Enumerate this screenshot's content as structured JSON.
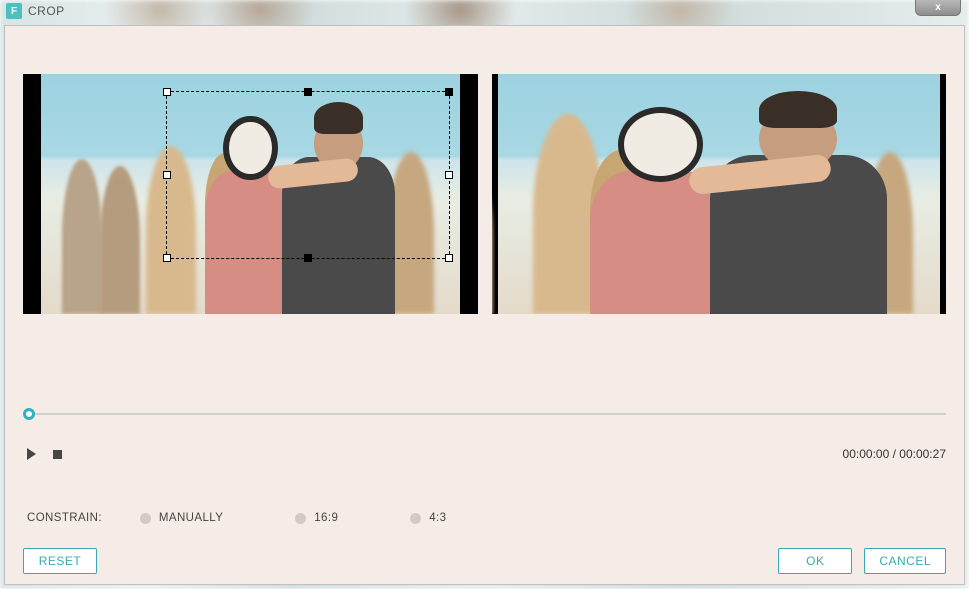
{
  "window": {
    "app_icon_letter": "F",
    "title": "CROP",
    "close_glyph": "x"
  },
  "crop": {
    "constrain_options": [
      "MANUALLY",
      "16:9",
      "4:3"
    ]
  },
  "playback": {
    "current_time": "00:00:00",
    "duration": "00:00:27",
    "separator": " / "
  },
  "labels": {
    "constrain": "CONSTRAIN:",
    "reset": "RESET",
    "ok": "OK",
    "cancel": "CANCEL"
  },
  "colors": {
    "accent": "#28b5c2"
  }
}
